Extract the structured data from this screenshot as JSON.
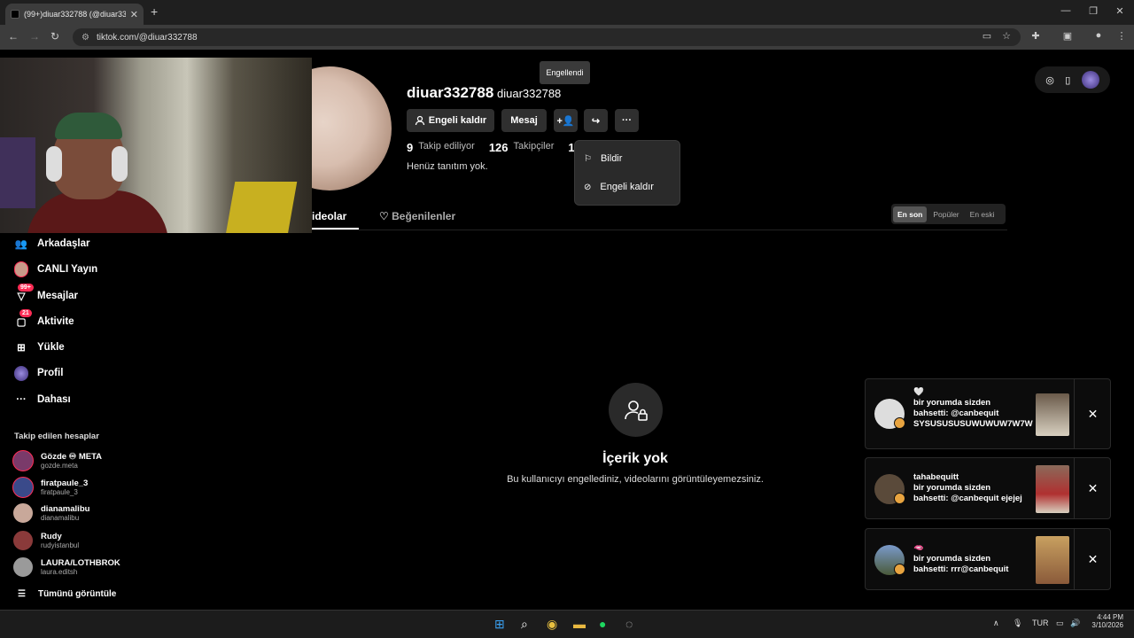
{
  "browser": {
    "tab_title": "(99+)diuar332788 (@diuar3327",
    "url": "tiktok.com/@diuar332788"
  },
  "profile": {
    "display_name": "diuar332788",
    "username": "diuar332788",
    "tooltip": "Engellendi",
    "unblock_label": "Engeli kaldır",
    "message_label": "Mesaj",
    "following_count": "9",
    "following_label": "Takip ediliyor",
    "followers_count": "126",
    "followers_label": "Takipçiler",
    "likes_count": "1",
    "likes_label_partial": "B",
    "bio": "Henüz tanıtım yok."
  },
  "menu": {
    "report": "Bildir",
    "unblock": "Engeli kaldır"
  },
  "tabs": {
    "videos": "ideolar",
    "liked": "Beğenilenler"
  },
  "sort": [
    "En son",
    "Popüler",
    "En eski"
  ],
  "empty": {
    "title": "İçerik yok",
    "subtitle": "Bu kullanıcıyı engellediniz, videolarını görüntüleyemezsiniz."
  },
  "sidebar": {
    "items": [
      {
        "label": "Arkadaşlar",
        "icon": "friends-icon"
      },
      {
        "label": "CANLI Yayın",
        "icon": "live-icon"
      },
      {
        "label": "Mesajlar",
        "icon": "messages-icon",
        "badge": "99+"
      },
      {
        "label": "Aktivite",
        "icon": "activity-icon",
        "badge": "21"
      },
      {
        "label": "Yükle",
        "icon": "upload-icon"
      },
      {
        "label": "Profil",
        "icon": "profile-icon"
      },
      {
        "label": "Dahası",
        "icon": "more-icon"
      }
    ],
    "following_title": "Takip edilen hesaplar",
    "following": [
      {
        "name": "Gözde ♾ META",
        "handle": "gozde.meta",
        "color": "#7a3a6a"
      },
      {
        "name": "firatpaule_3",
        "handle": "firatpaule_3",
        "color": "#3a4a8a"
      },
      {
        "name": "dianamalibu",
        "handle": "dianamalibu",
        "color": "#c8a89a"
      },
      {
        "name": "Rudy",
        "handle": "rudyistanbul",
        "color": "#8a3a3a"
      },
      {
        "name": "LAURA/LOTHBROK",
        "handle": "laura.editsh",
        "color": "#9a9a9a"
      }
    ],
    "see_all": "Tümünü görüntüle"
  },
  "notifications": [
    {
      "heading": "🤍",
      "text": "bir yorumda sizden bahsetti: @canbequit SYSUSUSUSUWUWUW7W7W"
    },
    {
      "heading": "tahabequitt",
      "text": "bir yorumda sizden bahsetti: @canbequit ejejej"
    },
    {
      "heading": "🫦",
      "text": "bir yorumda sizden bahsetti: rrr@canbequit"
    }
  ],
  "taskbar": {
    "lang": "TUR",
    "time": "4:44 PM",
    "date": "3/10/2026"
  }
}
